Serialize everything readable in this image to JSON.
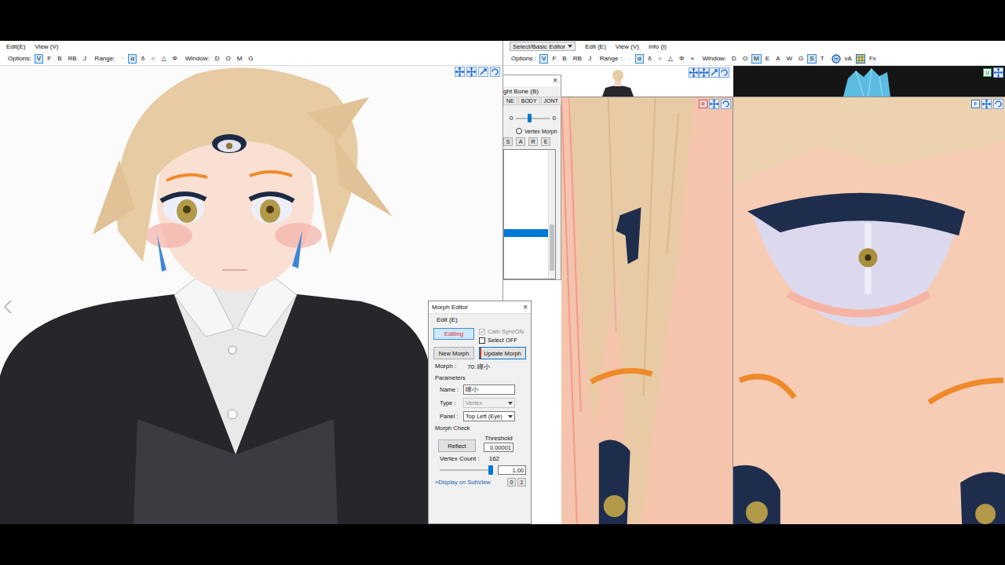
{
  "viewer": {
    "menu": [
      "Edit(E)",
      "View (V)"
    ],
    "options": {
      "label": "Options:",
      "toggles": [
        {
          "label": "V",
          "selected": true
        },
        {
          "label": "F",
          "selected": false
        },
        {
          "label": "B",
          "selected": false
        },
        {
          "label": "RB",
          "selected": false
        },
        {
          "label": "J",
          "selected": false
        }
      ],
      "range_label": "Range:",
      "range": [
        {
          "label": "·",
          "selected": false
        },
        {
          "label": "α",
          "selected": true
        },
        {
          "label": "δ",
          "selected": false
        },
        {
          "label": "○",
          "selected": false
        },
        {
          "label": "△",
          "selected": false
        },
        {
          "label": "Φ",
          "selected": false
        }
      ],
      "window_label": "Window:",
      "windows": [
        {
          "label": "D",
          "selected": false
        },
        {
          "label": "O",
          "selected": false
        },
        {
          "label": "M",
          "selected": false
        },
        {
          "label": "G",
          "selected": false
        }
      ]
    }
  },
  "editor": {
    "menu": [
      {
        "label": "Select/Basic Editor",
        "kind": "dropdown"
      },
      {
        "label": "Edit (E)",
        "kind": "item"
      },
      {
        "label": "View (V)",
        "kind": "item"
      },
      {
        "label": "Info (I)",
        "kind": "item"
      }
    ],
    "options": {
      "label": "Options :",
      "toggles": [
        {
          "label": "V",
          "selected": true
        },
        {
          "label": "F",
          "selected": false
        },
        {
          "label": "B",
          "selected": false
        },
        {
          "label": "RB",
          "selected": false
        },
        {
          "label": "J",
          "selected": false
        }
      ],
      "range_label": "Range :",
      "range": [
        {
          "label": "·",
          "selected": false
        },
        {
          "label": "α",
          "selected": true
        },
        {
          "label": "δ",
          "selected": false
        },
        {
          "label": "○",
          "selected": false
        },
        {
          "label": "△",
          "selected": false
        },
        {
          "label": "Φ",
          "selected": false
        },
        {
          "label": "×",
          "selected": false
        }
      ],
      "window_label": "Window:",
      "windows": [
        {
          "label": "D",
          "selected": false
        },
        {
          "label": "O",
          "selected": false
        },
        {
          "label": "M",
          "selected": true
        },
        {
          "label": "E",
          "selected": false
        },
        {
          "label": "A",
          "selected": false
        },
        {
          "label": "W",
          "selected": false
        },
        {
          "label": "G",
          "selected": false
        },
        {
          "label": "S",
          "selected": true
        },
        {
          "label": "T",
          "selected": false
        }
      ],
      "extras": [
        "vA",
        "Fx"
      ]
    },
    "views": [
      {
        "label": "U",
        "color": "#2a9d5c"
      },
      {
        "label": "R",
        "color": "#d0383a"
      },
      {
        "label": "F",
        "color": "#2a6fd0"
      }
    ]
  },
  "weight_window": {
    "title": "ght Bone (B)",
    "close": "×",
    "tabs": [
      {
        "label": "NE",
        "selected": false
      },
      {
        "label": "BODY",
        "selected": false
      },
      {
        "label": "JONT",
        "selected": false
      }
    ],
    "slider": {
      "min": "0",
      "max": "0",
      "level": 0.4
    },
    "radio": {
      "label": "Vertex Morph",
      "selected": false
    },
    "buttons": [
      "S",
      "A",
      "R",
      "E"
    ],
    "list": {
      "rows": [
        {
          "selected": false
        },
        {
          "selected": false
        },
        {
          "selected": false
        },
        {
          "selected": false
        },
        {
          "selected": false
        },
        {
          "selected": false
        },
        {
          "selected": false
        },
        {
          "selected": false
        },
        {
          "selected": false
        },
        {
          "selected": false
        },
        {
          "selected": true
        },
        {
          "selected": false
        }
      ],
      "scroll_start": 0.58,
      "scroll_size": 0.36
    }
  },
  "morph_editor": {
    "title": "Morph Editor",
    "close": "×",
    "menu": [
      "Edit (E)"
    ],
    "editing": {
      "label": "Editing",
      "selected": true
    },
    "checkboxes": [
      {
        "label": "Cam SyncON",
        "checked": true,
        "disabled": true
      },
      {
        "label": "Select OFF",
        "checked": false,
        "disabled": false
      }
    ],
    "buttons": [
      {
        "label": "New Morph",
        "selected": false
      },
      {
        "label": "Update Morph",
        "selected": true
      }
    ],
    "morph": {
      "label": "Morph :",
      "value": "70: 瞳小"
    },
    "parameters": {
      "title": "Parameters",
      "fields": [
        {
          "label": "Name :",
          "value": "瞳小",
          "kind": "text",
          "disabled": false
        },
        {
          "label": "Type :",
          "value": "Vertex",
          "kind": "select",
          "disabled": true
        },
        {
          "label": "Panel :",
          "value": "Top Left (Eye)",
          "kind": "select",
          "disabled": false
        }
      ]
    },
    "check": {
      "title": "Morph Check",
      "reflect": "Reflect",
      "threshold": {
        "label": "Threshold",
        "value": "0.00001"
      },
      "vertex_count": {
        "label": "Vertex Count :",
        "value": "162"
      },
      "slider": {
        "level": 1.0,
        "value": "1.00"
      },
      "subview": {
        "label": "»Display on SubView",
        "buttons": [
          "0",
          "1"
        ]
      }
    }
  }
}
